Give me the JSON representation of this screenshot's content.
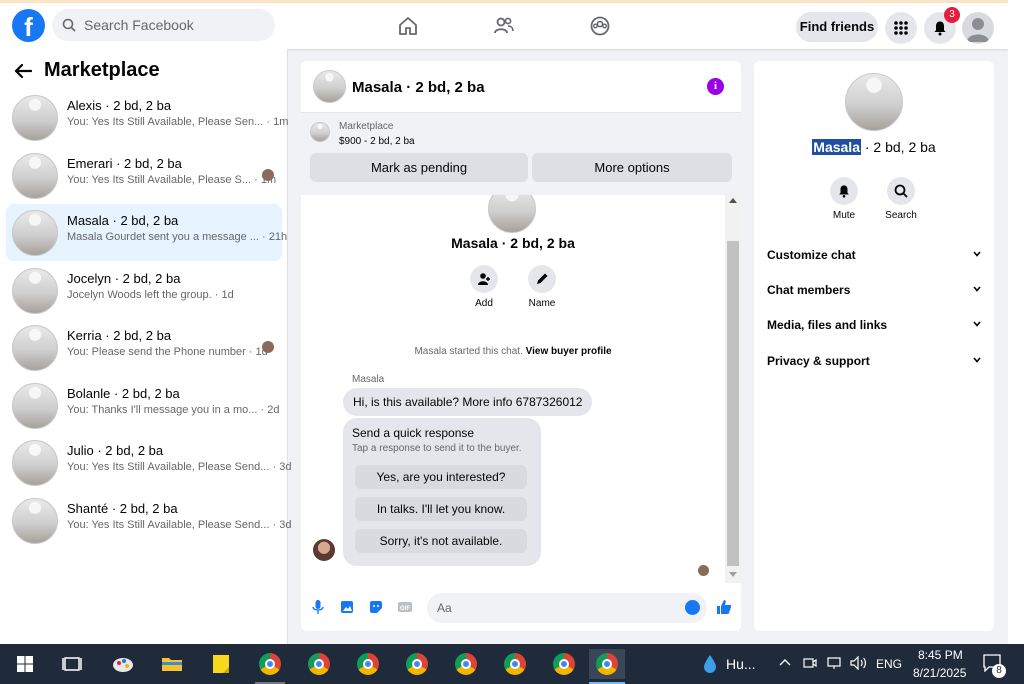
{
  "header": {
    "logo": "f",
    "search_placeholder": "Search Facebook",
    "find_friends": "Find friends",
    "notification_count": "3"
  },
  "sidebar": {
    "title": "Marketplace",
    "conversations": [
      {
        "name": "Alexis · 2 bd, 2 ba",
        "preview": "You: Yes Its Still Available, Please Sen... · 1m"
      },
      {
        "name": "Emerari · 2 bd, 2 ba",
        "preview": "You: Yes Its Still Available, Please S... · 1m"
      },
      {
        "name": "Masala · 2 bd, 2 ba",
        "preview": "Masala Gourdet sent you a message ... · 21h"
      },
      {
        "name": "Jocelyn · 2 bd, 2 ba",
        "preview": "Jocelyn Woods left the group. · 1d"
      },
      {
        "name": "Kerria · 2 bd, 2 ba",
        "preview": "You: Please send the Phone number · 1d"
      },
      {
        "name": "Bolanle · 2 bd, 2 ba",
        "preview": "You: Thanks I'll message you in a mo... · 2d"
      },
      {
        "name": "Julio · 2 bd, 2 ba",
        "preview": "You: Yes Its Still Available, Please Send... · 3d"
      },
      {
        "name": "Shanté · 2 bd, 2 ba",
        "preview": "You: Yes Its Still Available, Please Send... · 3d"
      }
    ]
  },
  "chat": {
    "title": "Masala · 2 bd, 2 ba",
    "info_icon": "i",
    "marketplace_label": "Marketplace",
    "listing_price": "$900 - 2 bd, 2 ba",
    "mark_pending": "Mark as pending",
    "more_options": "More options",
    "body_title": "Masala · 2 bd, 2 ba",
    "add_label": "Add",
    "name_label": "Name",
    "started_text": "Masala started this chat.",
    "view_buyer_profile": "View buyer profile",
    "sender": "Masala",
    "message": "Hi, is this available? More info 6787326012",
    "quick_title": "Send a quick response",
    "quick_subtitle": "Tap a response to send it to the buyer.",
    "quick_options": [
      "Yes, are you interested?",
      "In talks. I'll let you know.",
      "Sorry, it's not available."
    ],
    "composer_placeholder": "Aa"
  },
  "details": {
    "name_highlight": "Masala",
    "name_rest": " · 2 bd, 2 ba",
    "mute": "Mute",
    "search": "Search",
    "menu": [
      "Customize chat",
      "Chat members",
      "Media, files and links",
      "Privacy & support"
    ]
  },
  "taskbar": {
    "weather": "Hu...",
    "language": "ENG",
    "time": "8:45 PM",
    "date": "8/21/2025",
    "notifications": "8"
  }
}
